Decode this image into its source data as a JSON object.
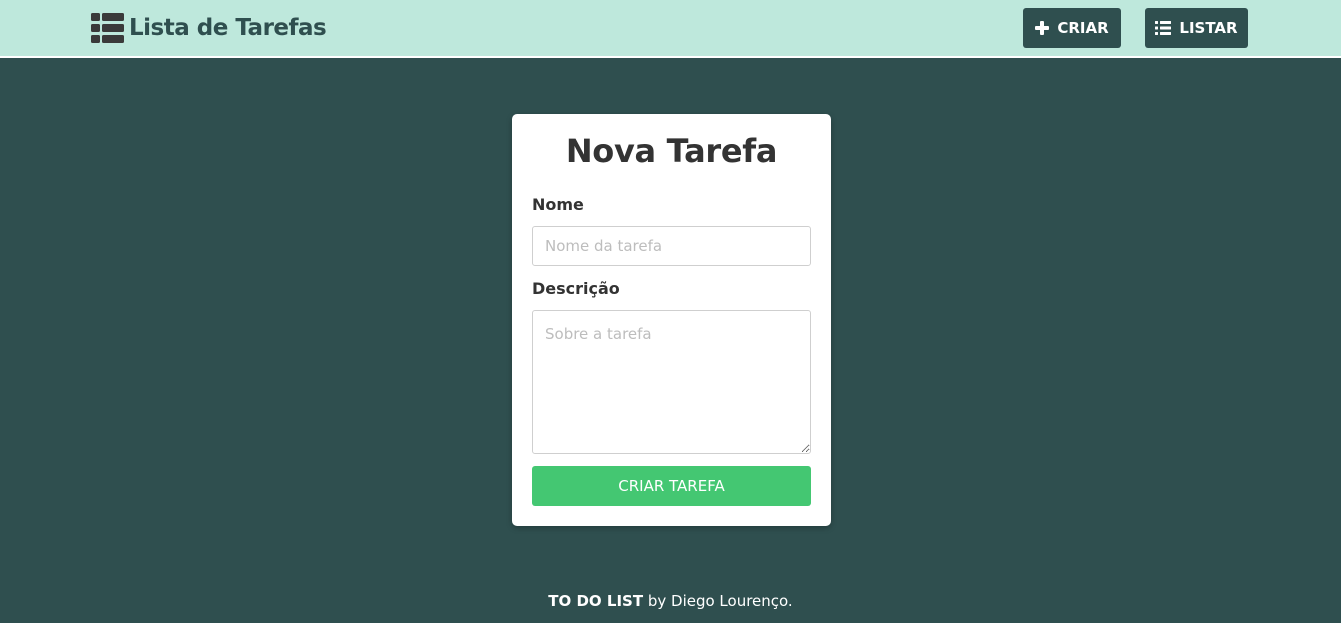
{
  "header": {
    "brand_text": "Lista de Tarefas",
    "brand_icon": "table-list-icon",
    "buttons": {
      "create": {
        "label": "CRIAR",
        "icon": "plus-icon"
      },
      "list": {
        "label": "LISTAR",
        "icon": "list-icon"
      }
    }
  },
  "form": {
    "title": "Nova Tarefa",
    "name_label": "Nome",
    "name_placeholder": "Nome da tarefa",
    "name_value": "",
    "description_label": "Descrição",
    "description_placeholder": "Sobre a tarefa",
    "description_value": "",
    "submit_label": "CRIAR TAREFA"
  },
  "footer": {
    "app_name": "TO DO LIST",
    "author_text": " by Diego Lourenço."
  },
  "colors": {
    "header_bg": "#bee8dc",
    "page_bg": "#2f4f4f",
    "accent_green": "#44c772",
    "nav_button_bg": "#2f4f4f"
  }
}
